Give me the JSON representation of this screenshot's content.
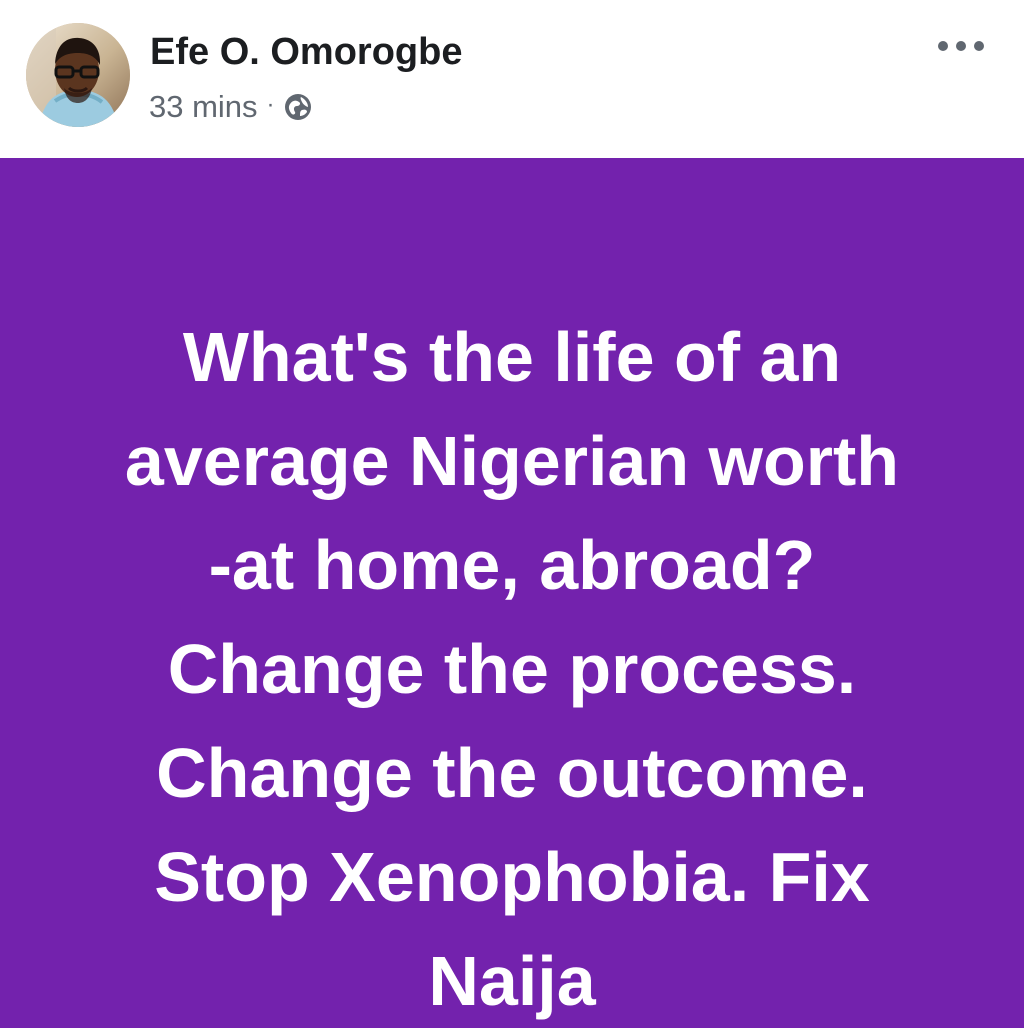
{
  "post": {
    "author": "Efe O. Omorogbe",
    "time": "33 mins",
    "separator": "·",
    "audience_icon": "globe-icon",
    "more_icon": "more-options-icon",
    "background_color": "#7322ad",
    "text_color": "#ffffff",
    "message": "What's the life of an\naverage Nigerian worth\n-at home, abroad?\nChange the process.\nChange the outcome.\nStop Xenophobia. Fix\nNaija"
  }
}
